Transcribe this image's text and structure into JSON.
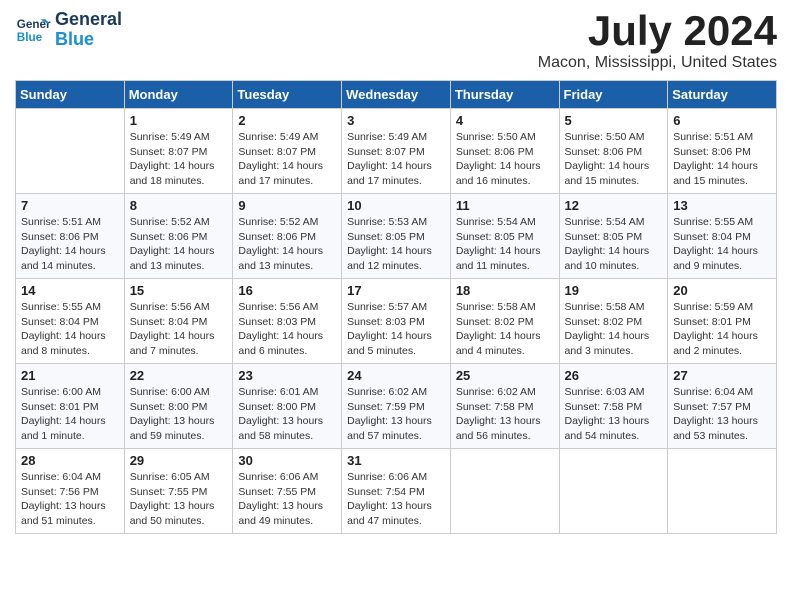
{
  "header": {
    "logo_line1": "General",
    "logo_line2": "Blue",
    "month": "July 2024",
    "location": "Macon, Mississippi, United States"
  },
  "weekdays": [
    "Sunday",
    "Monday",
    "Tuesday",
    "Wednesday",
    "Thursday",
    "Friday",
    "Saturday"
  ],
  "weeks": [
    [
      {
        "day": "",
        "info": ""
      },
      {
        "day": "1",
        "info": "Sunrise: 5:49 AM\nSunset: 8:07 PM\nDaylight: 14 hours\nand 18 minutes."
      },
      {
        "day": "2",
        "info": "Sunrise: 5:49 AM\nSunset: 8:07 PM\nDaylight: 14 hours\nand 17 minutes."
      },
      {
        "day": "3",
        "info": "Sunrise: 5:49 AM\nSunset: 8:07 PM\nDaylight: 14 hours\nand 17 minutes."
      },
      {
        "day": "4",
        "info": "Sunrise: 5:50 AM\nSunset: 8:06 PM\nDaylight: 14 hours\nand 16 minutes."
      },
      {
        "day": "5",
        "info": "Sunrise: 5:50 AM\nSunset: 8:06 PM\nDaylight: 14 hours\nand 15 minutes."
      },
      {
        "day": "6",
        "info": "Sunrise: 5:51 AM\nSunset: 8:06 PM\nDaylight: 14 hours\nand 15 minutes."
      }
    ],
    [
      {
        "day": "7",
        "info": "Sunrise: 5:51 AM\nSunset: 8:06 PM\nDaylight: 14 hours\nand 14 minutes."
      },
      {
        "day": "8",
        "info": "Sunrise: 5:52 AM\nSunset: 8:06 PM\nDaylight: 14 hours\nand 13 minutes."
      },
      {
        "day": "9",
        "info": "Sunrise: 5:52 AM\nSunset: 8:06 PM\nDaylight: 14 hours\nand 13 minutes."
      },
      {
        "day": "10",
        "info": "Sunrise: 5:53 AM\nSunset: 8:05 PM\nDaylight: 14 hours\nand 12 minutes."
      },
      {
        "day": "11",
        "info": "Sunrise: 5:54 AM\nSunset: 8:05 PM\nDaylight: 14 hours\nand 11 minutes."
      },
      {
        "day": "12",
        "info": "Sunrise: 5:54 AM\nSunset: 8:05 PM\nDaylight: 14 hours\nand 10 minutes."
      },
      {
        "day": "13",
        "info": "Sunrise: 5:55 AM\nSunset: 8:04 PM\nDaylight: 14 hours\nand 9 minutes."
      }
    ],
    [
      {
        "day": "14",
        "info": "Sunrise: 5:55 AM\nSunset: 8:04 PM\nDaylight: 14 hours\nand 8 minutes."
      },
      {
        "day": "15",
        "info": "Sunrise: 5:56 AM\nSunset: 8:04 PM\nDaylight: 14 hours\nand 7 minutes."
      },
      {
        "day": "16",
        "info": "Sunrise: 5:56 AM\nSunset: 8:03 PM\nDaylight: 14 hours\nand 6 minutes."
      },
      {
        "day": "17",
        "info": "Sunrise: 5:57 AM\nSunset: 8:03 PM\nDaylight: 14 hours\nand 5 minutes."
      },
      {
        "day": "18",
        "info": "Sunrise: 5:58 AM\nSunset: 8:02 PM\nDaylight: 14 hours\nand 4 minutes."
      },
      {
        "day": "19",
        "info": "Sunrise: 5:58 AM\nSunset: 8:02 PM\nDaylight: 14 hours\nand 3 minutes."
      },
      {
        "day": "20",
        "info": "Sunrise: 5:59 AM\nSunset: 8:01 PM\nDaylight: 14 hours\nand 2 minutes."
      }
    ],
    [
      {
        "day": "21",
        "info": "Sunrise: 6:00 AM\nSunset: 8:01 PM\nDaylight: 14 hours\nand 1 minute."
      },
      {
        "day": "22",
        "info": "Sunrise: 6:00 AM\nSunset: 8:00 PM\nDaylight: 13 hours\nand 59 minutes."
      },
      {
        "day": "23",
        "info": "Sunrise: 6:01 AM\nSunset: 8:00 PM\nDaylight: 13 hours\nand 58 minutes."
      },
      {
        "day": "24",
        "info": "Sunrise: 6:02 AM\nSunset: 7:59 PM\nDaylight: 13 hours\nand 57 minutes."
      },
      {
        "day": "25",
        "info": "Sunrise: 6:02 AM\nSunset: 7:58 PM\nDaylight: 13 hours\nand 56 minutes."
      },
      {
        "day": "26",
        "info": "Sunrise: 6:03 AM\nSunset: 7:58 PM\nDaylight: 13 hours\nand 54 minutes."
      },
      {
        "day": "27",
        "info": "Sunrise: 6:04 AM\nSunset: 7:57 PM\nDaylight: 13 hours\nand 53 minutes."
      }
    ],
    [
      {
        "day": "28",
        "info": "Sunrise: 6:04 AM\nSunset: 7:56 PM\nDaylight: 13 hours\nand 51 minutes."
      },
      {
        "day": "29",
        "info": "Sunrise: 6:05 AM\nSunset: 7:55 PM\nDaylight: 13 hours\nand 50 minutes."
      },
      {
        "day": "30",
        "info": "Sunrise: 6:06 AM\nSunset: 7:55 PM\nDaylight: 13 hours\nand 49 minutes."
      },
      {
        "day": "31",
        "info": "Sunrise: 6:06 AM\nSunset: 7:54 PM\nDaylight: 13 hours\nand 47 minutes."
      },
      {
        "day": "",
        "info": ""
      },
      {
        "day": "",
        "info": ""
      },
      {
        "day": "",
        "info": ""
      }
    ]
  ]
}
